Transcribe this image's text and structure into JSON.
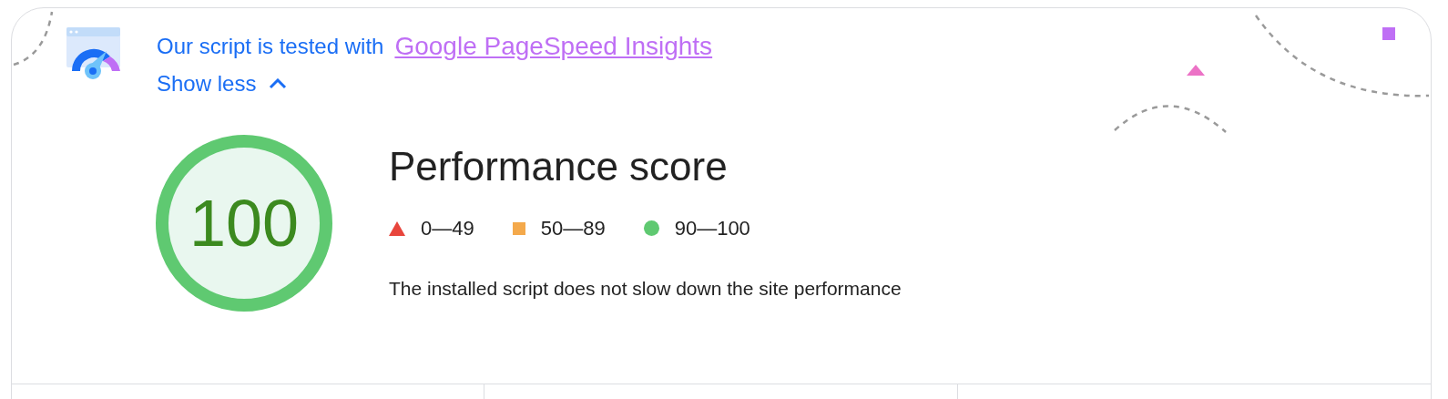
{
  "notice": {
    "text": "Our script is tested with",
    "link": "Google PageSpeed Insights",
    "toggle": "Show less",
    "expanded": true
  },
  "score": {
    "value": "100",
    "color": "#5fc971",
    "title": "Performance score"
  },
  "legend": [
    {
      "kind": "triangle",
      "color": "#e8453c",
      "label": "0—49"
    },
    {
      "kind": "square",
      "color": "#f4a94b",
      "label": "50—89"
    },
    {
      "kind": "circle",
      "color": "#5fc971",
      "label": "90—100"
    }
  ],
  "description": "The installed script does not slow down the site performance"
}
